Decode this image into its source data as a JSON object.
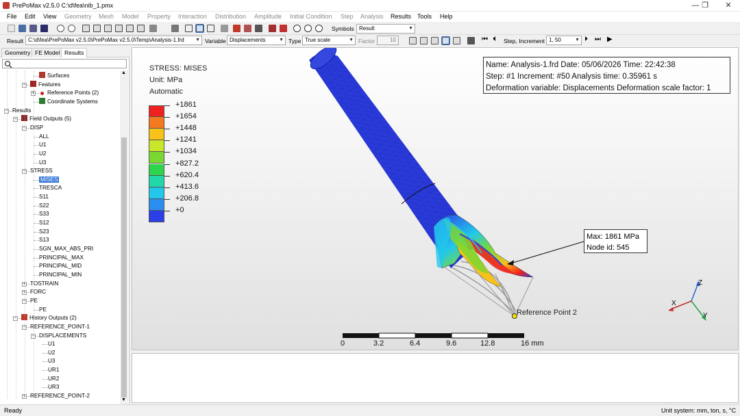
{
  "window": {
    "title": "PrePoMax v2.5.0   C:\\d\\fea\\nib_1.pmx",
    "controls": [
      "—",
      "❐",
      "✕"
    ]
  },
  "menu": [
    {
      "label": "File",
      "enabled": true
    },
    {
      "label": "Edit",
      "enabled": true
    },
    {
      "label": "View",
      "enabled": true
    },
    {
      "label": "Geometry",
      "enabled": false
    },
    {
      "label": "Mesh",
      "enabled": false
    },
    {
      "label": "Model",
      "enabled": false
    },
    {
      "label": "Property",
      "enabled": false
    },
    {
      "label": "Interaction",
      "enabled": false
    },
    {
      "label": "Distribution",
      "enabled": false
    },
    {
      "label": "Amplitude",
      "enabled": false
    },
    {
      "label": "Initial Condition",
      "enabled": false
    },
    {
      "label": "Step",
      "enabled": false
    },
    {
      "label": "Analysis",
      "enabled": false
    },
    {
      "label": "Results",
      "enabled": true
    },
    {
      "label": "Tools",
      "enabled": true
    },
    {
      "label": "Help",
      "enabled": true
    }
  ],
  "toolbar": {
    "symbols_label": "Symbols",
    "symbols_value": "Result"
  },
  "results_bar": {
    "result_label": "Result",
    "result_path": "C:\\d\\fea\\PrePoMax v2.5.0\\PrePoMax v2.5.0\\Temp\\Analysis-1.frd",
    "variable_label": "Variable",
    "variable_value": "Displacements",
    "type_label": "Type",
    "type_value": "True scale",
    "factor_label": "Factor",
    "factor_value": "10",
    "step_increment_label": "Step, Increment",
    "step_increment_value": "1, 50"
  },
  "tabs": [
    "Geometry",
    "FE Model",
    "Results"
  ],
  "active_tab": "Results",
  "tree": [
    {
      "label": "Surfaces",
      "level": 3,
      "icon": "surface-icon"
    },
    {
      "label": "Features",
      "level": 2,
      "icon": "features-icon",
      "expander": "−"
    },
    {
      "label": "Reference Points (2)",
      "level": 3,
      "icon": "reference-point-icon",
      "expander": "+"
    },
    {
      "label": "Coordinate Systems",
      "level": 3,
      "icon": "coordinate-system-icon"
    },
    {
      "label": "Results",
      "level": 0,
      "icon": "",
      "expander": "−"
    },
    {
      "label": "Field Outputs (5)",
      "level": 1,
      "icon": "field-output-icon",
      "expander": "−"
    },
    {
      "label": "DISP",
      "level": 2,
      "icon": "",
      "expander": "−"
    },
    {
      "label": "ALL",
      "level": 3,
      "icon": ""
    },
    {
      "label": "U1",
      "level": 3,
      "icon": ""
    },
    {
      "label": "U2",
      "level": 3,
      "icon": ""
    },
    {
      "label": "U3",
      "level": 3,
      "icon": ""
    },
    {
      "label": "STRESS",
      "level": 2,
      "icon": "",
      "expander": "−"
    },
    {
      "label": "MISES",
      "level": 3,
      "icon": "",
      "selected": true
    },
    {
      "label": "TRESCA",
      "level": 3,
      "icon": ""
    },
    {
      "label": "S11",
      "level": 3,
      "icon": ""
    },
    {
      "label": "S22",
      "level": 3,
      "icon": ""
    },
    {
      "label": "S33",
      "level": 3,
      "icon": ""
    },
    {
      "label": "S12",
      "level": 3,
      "icon": ""
    },
    {
      "label": "S23",
      "level": 3,
      "icon": ""
    },
    {
      "label": "S13",
      "level": 3,
      "icon": ""
    },
    {
      "label": "SGN_MAX_ABS_PRI",
      "level": 3,
      "icon": ""
    },
    {
      "label": "PRINCIPAL_MAX",
      "level": 3,
      "icon": ""
    },
    {
      "label": "PRINCIPAL_MID",
      "level": 3,
      "icon": ""
    },
    {
      "label": "PRINCIPAL_MIN",
      "level": 3,
      "icon": ""
    },
    {
      "label": "TOSTRAIN",
      "level": 2,
      "icon": "",
      "expander": "+"
    },
    {
      "label": "FORC",
      "level": 2,
      "icon": "",
      "expander": "+"
    },
    {
      "label": "PE",
      "level": 2,
      "icon": "",
      "expander": "−"
    },
    {
      "label": "PE",
      "level": 3,
      "icon": ""
    },
    {
      "label": "History Outputs (2)",
      "level": 1,
      "icon": "history-output-icon",
      "expander": "−"
    },
    {
      "label": "REFERENCE_POINT-1",
      "level": 2,
      "icon": "",
      "expander": "−"
    },
    {
      "label": "DISPLACEMENTS",
      "level": 3,
      "icon": "",
      "expander": "−"
    },
    {
      "label": "U1",
      "level": 4,
      "icon": ""
    },
    {
      "label": "U2",
      "level": 4,
      "icon": ""
    },
    {
      "label": "U3",
      "level": 4,
      "icon": ""
    },
    {
      "label": "UR1",
      "level": 4,
      "icon": ""
    },
    {
      "label": "UR2",
      "level": 4,
      "icon": ""
    },
    {
      "label": "UR3",
      "level": 4,
      "icon": ""
    },
    {
      "label": "REFERENCE_POINT-2",
      "level": 2,
      "icon": "",
      "expander": "+"
    }
  ],
  "legend": {
    "title": "STRESS: MISES",
    "unit": "Unit: MPa",
    "mode": "Automatic",
    "values": [
      "+1861",
      "+1654",
      "+1448",
      "+1241",
      "+1034",
      "+827.2",
      "+620.4",
      "+413.6",
      "+206.8",
      "+0"
    ],
    "colors": [
      "#ee2020",
      "#f47a1e",
      "#f7c21a",
      "#c8e62a",
      "#7ad832",
      "#2ed44c",
      "#20d8a8",
      "#22c8ec",
      "#2a8ef0",
      "#2a40e6"
    ]
  },
  "info": {
    "line1": "Name: Analysis-1.frd   Date: 05/06/2026   Time: 22:42:38",
    "line2": "Step: #1   Increment: #50   Analysis time: 0.35961 s",
    "line3": "Deformation variable: Displacements   Deformation scale factor: 1"
  },
  "max_label": {
    "line1": "Max: 1861 MPa",
    "line2": "Node id: 545"
  },
  "reference_point_label": "Reference Point 2",
  "scale_bar": {
    "ticks": [
      "0",
      "3.2",
      "6.4",
      "9.6",
      "12.8",
      "16 mm"
    ]
  },
  "axes": {
    "x": "X",
    "y": "Y",
    "z": "Z"
  },
  "status": {
    "left": "Ready",
    "right": "Unit system: mm, ton, s, °C"
  }
}
